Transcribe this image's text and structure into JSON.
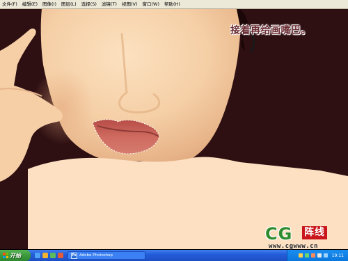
{
  "menu": {
    "items": [
      "文件(F)",
      "编辑(E)",
      "图像(I)",
      "图层(L)",
      "选择(S)",
      "滤镜(T)",
      "视图(V)",
      "窗口(W)",
      "帮助(H)"
    ]
  },
  "canvas": {
    "annotation": "接着再给画嘴巴。",
    "colors": {
      "background": "#2e0f12",
      "skin": "#fbdcbc",
      "lips": "#c76258",
      "lips_dark": "#8e3a35"
    }
  },
  "watermark": {
    "logo": "CG",
    "tag": "阵线",
    "url": "www.cgwww.cn"
  },
  "taskbar": {
    "start_label": "开始",
    "window_label": "Adobe Photoshop",
    "clock": "19:11",
    "colors": {
      "bar": "#245dda",
      "start": "#3c9a3c",
      "tray": "#0b77dd"
    }
  }
}
